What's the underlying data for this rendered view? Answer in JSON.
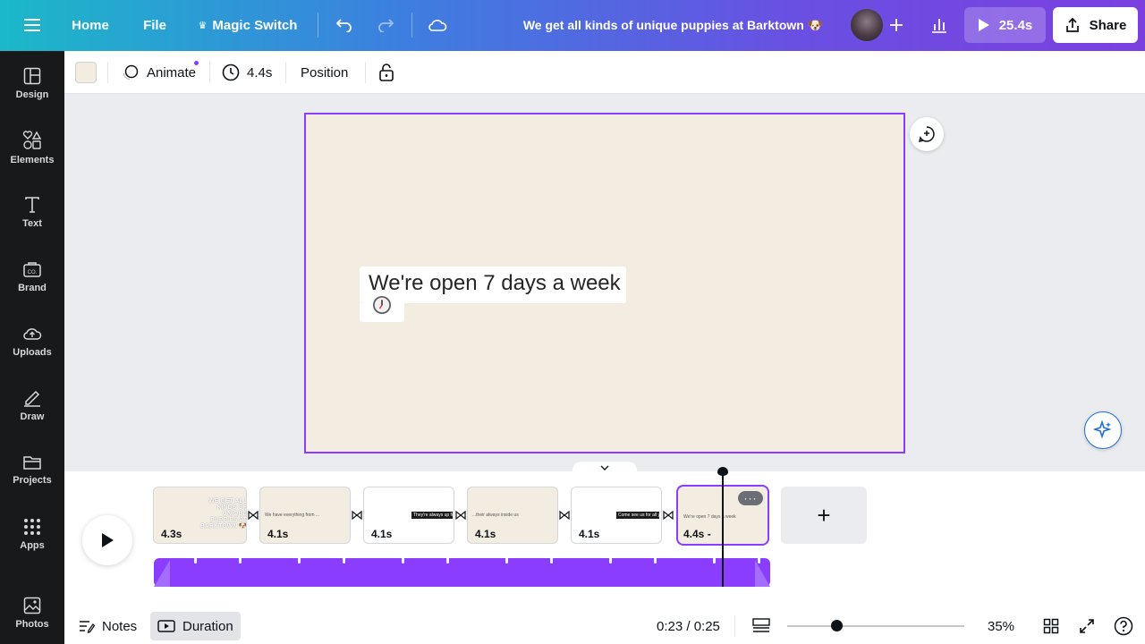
{
  "topbar": {
    "home": "Home",
    "file": "File",
    "magic_switch": "Magic Switch",
    "doc_title": "We get all kinds of unique puppies at Barktown 🐶",
    "play_time": "25.4s",
    "share": "Share"
  },
  "sidebar": {
    "items": [
      {
        "label": "Design",
        "icon": "design-icon"
      },
      {
        "label": "Elements",
        "icon": "elements-icon"
      },
      {
        "label": "Text",
        "icon": "text-icon"
      },
      {
        "label": "Brand",
        "icon": "brand-icon"
      },
      {
        "label": "Uploads",
        "icon": "uploads-icon"
      },
      {
        "label": "Draw",
        "icon": "draw-icon"
      },
      {
        "label": "Projects",
        "icon": "projects-icon"
      },
      {
        "label": "Apps",
        "icon": "apps-icon"
      },
      {
        "label": "Photos",
        "icon": "photos-icon"
      }
    ]
  },
  "toolbar": {
    "animate": "Animate",
    "timing": "4.4s",
    "position": "Position",
    "bg_color": "#f3ece1"
  },
  "canvas": {
    "text": "We're open 7 days a week",
    "clock_emoji": "🕔"
  },
  "timeline": {
    "pages": [
      {
        "duration": "4.3s",
        "preview": "WE GET ALL KINDS OF UNIQUE PUPPIES AT BARKTOWN 🐶"
      },
      {
        "duration": "4.1s",
        "preview": "We have everything from ..."
      },
      {
        "duration": "4.1s",
        "preview": "They're always up for a good playdate"
      },
      {
        "duration": "4.1s",
        "preview": "...their always inside us"
      },
      {
        "duration": "4.1s",
        "preview": "Come see us for all your puppy needs"
      },
      {
        "duration": "4.4s -",
        "preview": "We're open 7 days a week"
      }
    ],
    "add_page": "+"
  },
  "bottombar": {
    "notes": "Notes",
    "duration": "Duration",
    "time": "0:23 / 0:25",
    "zoom": "35%",
    "zoom_fraction": 0.28
  },
  "colors": {
    "accent": "#8b3dff",
    "sidebar_bg": "#18191b"
  }
}
